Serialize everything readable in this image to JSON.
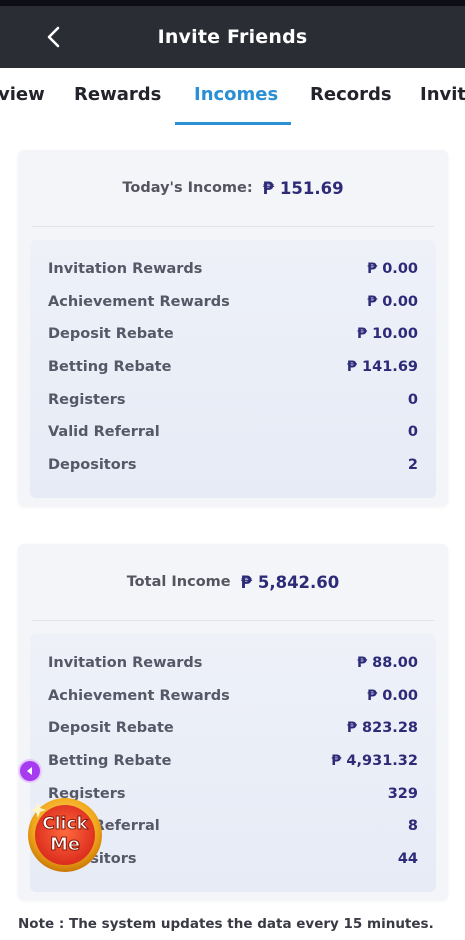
{
  "header": {
    "title": "Invite Friends"
  },
  "tabs": [
    {
      "label": "view"
    },
    {
      "label": "Rewards"
    },
    {
      "label": "Incomes"
    },
    {
      "label": "Records"
    },
    {
      "label": "Invit"
    }
  ],
  "today": {
    "title": "Today's Income:",
    "amount": "₱ 151.69",
    "rows": [
      {
        "label": "Invitation Rewards",
        "value": "₱ 0.00"
      },
      {
        "label": "Achievement Rewards",
        "value": "₱ 0.00"
      },
      {
        "label": "Deposit Rebate",
        "value": "₱ 10.00"
      },
      {
        "label": "Betting Rebate",
        "value": "₱ 141.69"
      },
      {
        "label": "Registers",
        "value": "0"
      },
      {
        "label": "Valid Referral",
        "value": "0"
      },
      {
        "label": "Depositors",
        "value": "2"
      }
    ]
  },
  "total": {
    "title": "Total Income",
    "amount": "₱ 5,842.60",
    "rows": [
      {
        "label": "Invitation Rewards",
        "value": "₱ 88.00"
      },
      {
        "label": "Achievement Rewards",
        "value": "₱ 0.00"
      },
      {
        "label": "Deposit Rebate",
        "value": "₱ 823.28"
      },
      {
        "label": "Betting Rebate",
        "value": "₱ 4,931.32"
      },
      {
        "label": "Registers",
        "value": "329"
      },
      {
        "label": "Valid Referral",
        "value": "8"
      },
      {
        "label": "Depositors",
        "value": "44"
      }
    ]
  },
  "note": "Note : The system updates the data every 15 minutes.",
  "float": {
    "badge_line1": "Click",
    "badge_line2": "Me",
    "arrow_icon": "chevron-left-icon"
  },
  "colors": {
    "accent": "#2a8fd3",
    "value": "#2d2b78",
    "header_bg": "#2a2d33"
  }
}
